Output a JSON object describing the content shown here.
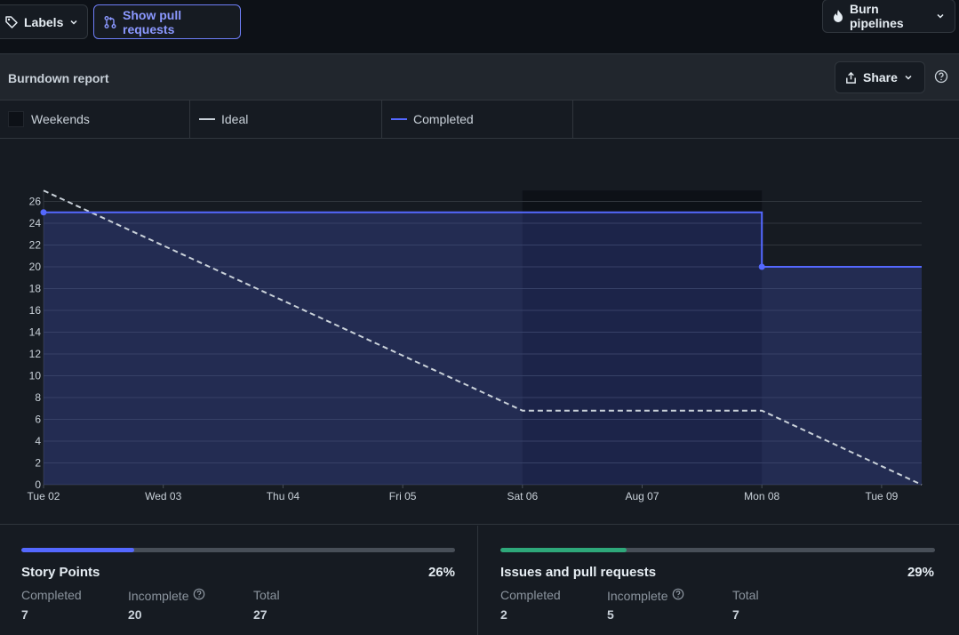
{
  "toolbar": {
    "labels_label": "Labels",
    "show_prs_label": "Show pull requests",
    "burn_pipelines_label": "Burn pipelines"
  },
  "report": {
    "title": "Burndown report",
    "share_label": "Share"
  },
  "legend": {
    "weekends": "Weekends",
    "ideal": "Ideal",
    "completed": "Completed"
  },
  "colors": {
    "completed": "#5468ff",
    "ideal": "#c9d1d9",
    "weekend": "#0d1117",
    "story_points_bar": "#5468ff",
    "issues_bar": "#2ea87a"
  },
  "chart_data": {
    "type": "line",
    "title": "",
    "xlabel": "",
    "ylabel": "",
    "x": [
      "Tue 02",
      "Wed 03",
      "Thu 04",
      "Fri 05",
      "Sat 06",
      "Aug 07",
      "Mon 08",
      "Tue 09"
    ],
    "ylim": [
      0,
      27
    ],
    "yticks": [
      0,
      2,
      4,
      6,
      8,
      10,
      12,
      14,
      16,
      18,
      20,
      22,
      24,
      26
    ],
    "weekend_range": [
      "Sat 06",
      "Mon 08"
    ],
    "grid": true,
    "legend_position": "top",
    "series": [
      {
        "name": "Ideal",
        "style": "dashed",
        "points": [
          [
            0,
            27
          ],
          [
            4,
            6.8
          ],
          [
            6,
            6.8
          ],
          [
            7.35,
            0
          ]
        ]
      },
      {
        "name": "Completed",
        "style": "step",
        "points": [
          [
            0,
            25
          ],
          [
            6,
            25
          ],
          [
            6,
            20
          ],
          [
            7.35,
            20
          ]
        ],
        "markers": [
          [
            0,
            25
          ],
          [
            6,
            20
          ]
        ]
      }
    ]
  },
  "stats": {
    "story_points": {
      "title": "Story Points",
      "percent": "26%",
      "progress": 0.26,
      "completed_label": "Completed",
      "completed_value": "7",
      "incomplete_label": "Incomplete",
      "incomplete_value": "20",
      "total_label": "Total",
      "total_value": "27"
    },
    "issues": {
      "title": "Issues and pull requests",
      "percent": "29%",
      "progress": 0.29,
      "completed_label": "Completed",
      "completed_value": "2",
      "incomplete_label": "Incomplete",
      "incomplete_value": "5",
      "total_label": "Total",
      "total_value": "7"
    }
  }
}
